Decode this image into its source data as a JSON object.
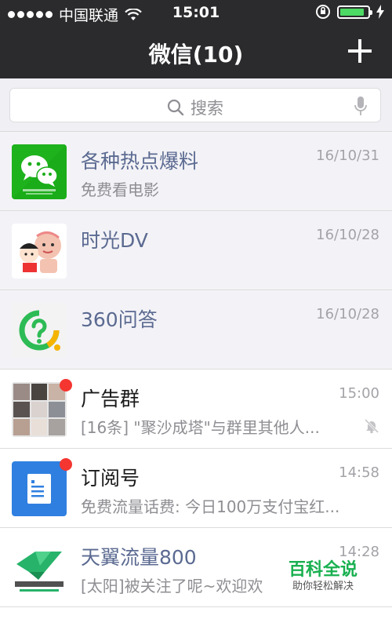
{
  "status_bar": {
    "carrier": "中国联通",
    "time": "15:01"
  },
  "nav": {
    "title": "微信(10)",
    "add_icon": "plus-icon"
  },
  "search": {
    "placeholder": "搜索",
    "icons": [
      "search-icon",
      "microphone-icon"
    ]
  },
  "chats": [
    {
      "name": "各种热点爆料",
      "preview": "免费看电影",
      "time": "16/10/31",
      "pinned": true,
      "blue": true,
      "avatar_icon": "wechat-logo-avatar"
    },
    {
      "name": "时光DV",
      "preview": "",
      "time": "16/10/28",
      "pinned": true,
      "blue": true,
      "avatar_icon": "cartoon-avatar"
    },
    {
      "name": "360问答",
      "preview": "",
      "time": "16/10/28",
      "pinned": true,
      "blue": true,
      "avatar_icon": "question-logo-avatar"
    },
    {
      "name": "广告群",
      "preview": "[16条] \"聚沙成塔\"与群里其他人...",
      "time": "15:00",
      "muted": true,
      "unread_dot": true,
      "avatar_icon": "group-photo-avatar"
    },
    {
      "name": "订阅号",
      "preview": "免费流量话费: 今日100万支付宝红...",
      "time": "14:58",
      "unread_dot": true,
      "avatar_icon": "subscription-icon"
    },
    {
      "name": "天翼流量800",
      "preview": "[太阳]被关注了呢~欢迎欢",
      "time": "14:28",
      "blue": true,
      "avatar_icon": "tianyi-logo-avatar"
    }
  ],
  "watermark": {
    "title": "百科全说",
    "subtitle": "助你轻松解决"
  },
  "colors": {
    "bar": "#2b2b2d",
    "wechat_green": "#1aad19",
    "badge_red": "#f43530",
    "name_blue": "#5b6a91"
  }
}
